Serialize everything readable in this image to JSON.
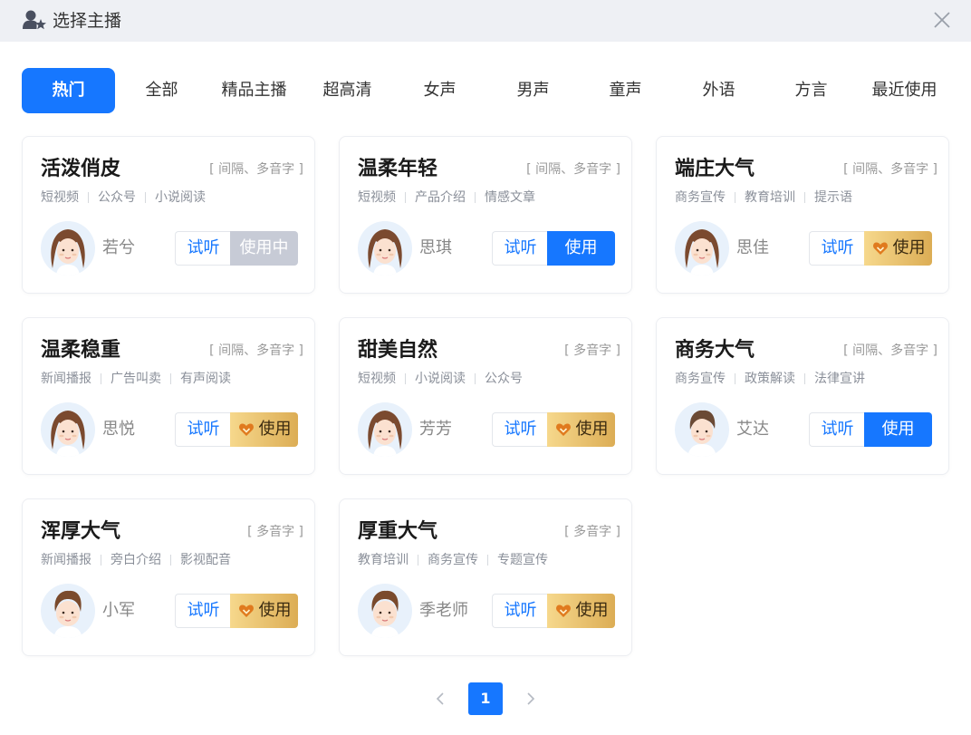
{
  "dialog": {
    "title": "选择主播"
  },
  "tabs": [
    {
      "label": "热门",
      "active": true
    },
    {
      "label": "全部"
    },
    {
      "label": "精品主播"
    },
    {
      "label": "超高清"
    },
    {
      "label": "女声"
    },
    {
      "label": "男声"
    },
    {
      "label": "童声"
    },
    {
      "label": "外语"
    },
    {
      "label": "方言"
    },
    {
      "label": "最近使用"
    }
  ],
  "cards": [
    {
      "title": "活泼俏皮",
      "features": "[ 间隔、多音字 ]",
      "tags": [
        "短视频",
        "公众号",
        "小说阅读"
      ],
      "voice": "若兮",
      "listen": "试听",
      "use": "使用中",
      "use_style": "inuse",
      "avatar": "female-avatar"
    },
    {
      "title": "温柔年轻",
      "features": "[ 间隔、多音字 ]",
      "tags": [
        "短视频",
        "产品介绍",
        "情感文章"
      ],
      "voice": "思琪",
      "listen": "试听",
      "use": "使用",
      "use_style": "blue",
      "avatar": "female-avatar"
    },
    {
      "title": "端庄大气",
      "features": "[ 间隔、多音字 ]",
      "tags": [
        "商务宣传",
        "教育培训",
        "提示语"
      ],
      "voice": "思佳",
      "listen": "试听",
      "use": "使用",
      "use_style": "vip",
      "avatar": "female-avatar"
    },
    {
      "title": "温柔稳重",
      "features": "[ 间隔、多音字 ]",
      "tags": [
        "新闻播报",
        "广告叫卖",
        "有声阅读"
      ],
      "voice": "思悦",
      "listen": "试听",
      "use": "使用",
      "use_style": "vip",
      "avatar": "female-avatar"
    },
    {
      "title": "甜美自然",
      "features": "[ 多音字 ]",
      "tags": [
        "短视频",
        "小说阅读",
        "公众号"
      ],
      "voice": "芳芳",
      "listen": "试听",
      "use": "使用",
      "use_style": "vip",
      "avatar": "female-avatar"
    },
    {
      "title": "商务大气",
      "features": "[ 间隔、多音字 ]",
      "tags": [
        "商务宣传",
        "政策解读",
        "法律宣讲"
      ],
      "voice": "艾达",
      "listen": "试听",
      "use": "使用",
      "use_style": "blue",
      "avatar": "male-avatar"
    },
    {
      "title": "浑厚大气",
      "features": "[ 多音字 ]",
      "tags": [
        "新闻播报",
        "旁白介绍",
        "影视配音"
      ],
      "voice": "小军",
      "listen": "试听",
      "use": "使用",
      "use_style": "vip",
      "avatar": "male-glasses-avatar"
    },
    {
      "title": "厚重大气",
      "features": "[ 多音字 ]",
      "tags": [
        "教育培训",
        "商务宣传",
        "专题宣传"
      ],
      "voice": "季老师",
      "listen": "试听",
      "use": "使用",
      "use_style": "vip",
      "avatar": "male-glasses-avatar"
    }
  ],
  "pagination": {
    "current": "1"
  },
  "colors": {
    "accent": "#1677ff",
    "in_use": "#c7cbd6",
    "vip_gold": "#dcad55"
  }
}
